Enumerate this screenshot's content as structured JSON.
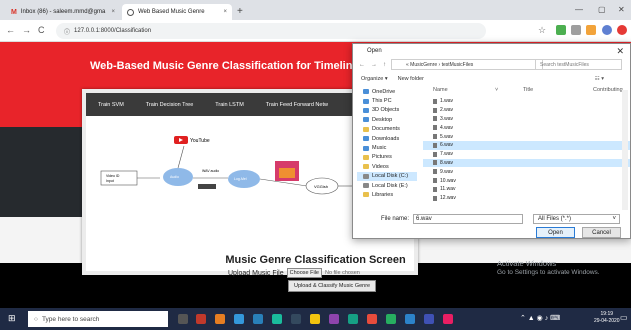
{
  "browser": {
    "tabs": [
      {
        "label": "Inbox (86) - saleem.mmd@gma",
        "icon": "gmail-icon"
      },
      {
        "label": "Web Based Music Genre",
        "icon": "globe-icon"
      }
    ],
    "url": "127.0.0.1:8000/Classification"
  },
  "page": {
    "hero_title": "Web-Based Music Genre Classification for Timeline Song Vis",
    "nav": [
      "Train SVM",
      "Train Decision Tree",
      "Train LSTM",
      "Train Feed Forward Netw"
    ],
    "diagram": {
      "youtube_label": "YouTube",
      "box1": "Video ID\nInput",
      "node_audio": "Audio\nfeature",
      "node_logmel": "Log-Mel\nfeature",
      "node_model": "VGGish",
      "arrow1": "Video ID",
      "arrow2": "WAV audio",
      "spec_label": "Spectrogram"
    },
    "section_title": "Music Genre Classification Screen",
    "upload_label": "Upload Music File",
    "choose_button": "Choose File",
    "no_file": "No file chosen",
    "submit_button": "Upload & Classify Music Genre"
  },
  "dialog": {
    "title": "Open",
    "breadcrumb": "« MusicGenre › testMusicFiles",
    "search_placeholder": "Search testMusicFiles",
    "organize": "Organize ▾",
    "new_folder": "New folder",
    "nav_items": [
      "OneDrive",
      "This PC",
      "3D Objects",
      "Desktop",
      "Documents",
      "Downloads",
      "Music",
      "Pictures",
      "Videos",
      "Local Disk (C:)",
      "Local Disk (E:)",
      "Libraries"
    ],
    "columns": {
      "name": "Name",
      "title": "Title",
      "contrib": "Contributing"
    },
    "files": [
      "1.wav",
      "2.wav",
      "3.wav",
      "4.wav",
      "5.wav",
      "6.wav",
      "7.wav",
      "8.wav",
      "9.wav",
      "10.wav",
      "11.wav",
      "12.wav"
    ],
    "selected_file": "6.wav",
    "filename_label": "File name:",
    "filename_value": "6.wav",
    "filetype": "All Files (*.*)",
    "open_button": "Open",
    "cancel_button": "Cancel"
  },
  "os": {
    "search_placeholder": "Type here to search",
    "watermark_line1": "Activate Windows",
    "watermark_line2": "Go to Settings to activate Windows.",
    "clock_time": "19:19",
    "clock_date": "29-04-2020"
  },
  "colors": {
    "hero_red": "#e8242a",
    "dark_band": "#262a2e",
    "taskbar": "#1f2a44"
  }
}
